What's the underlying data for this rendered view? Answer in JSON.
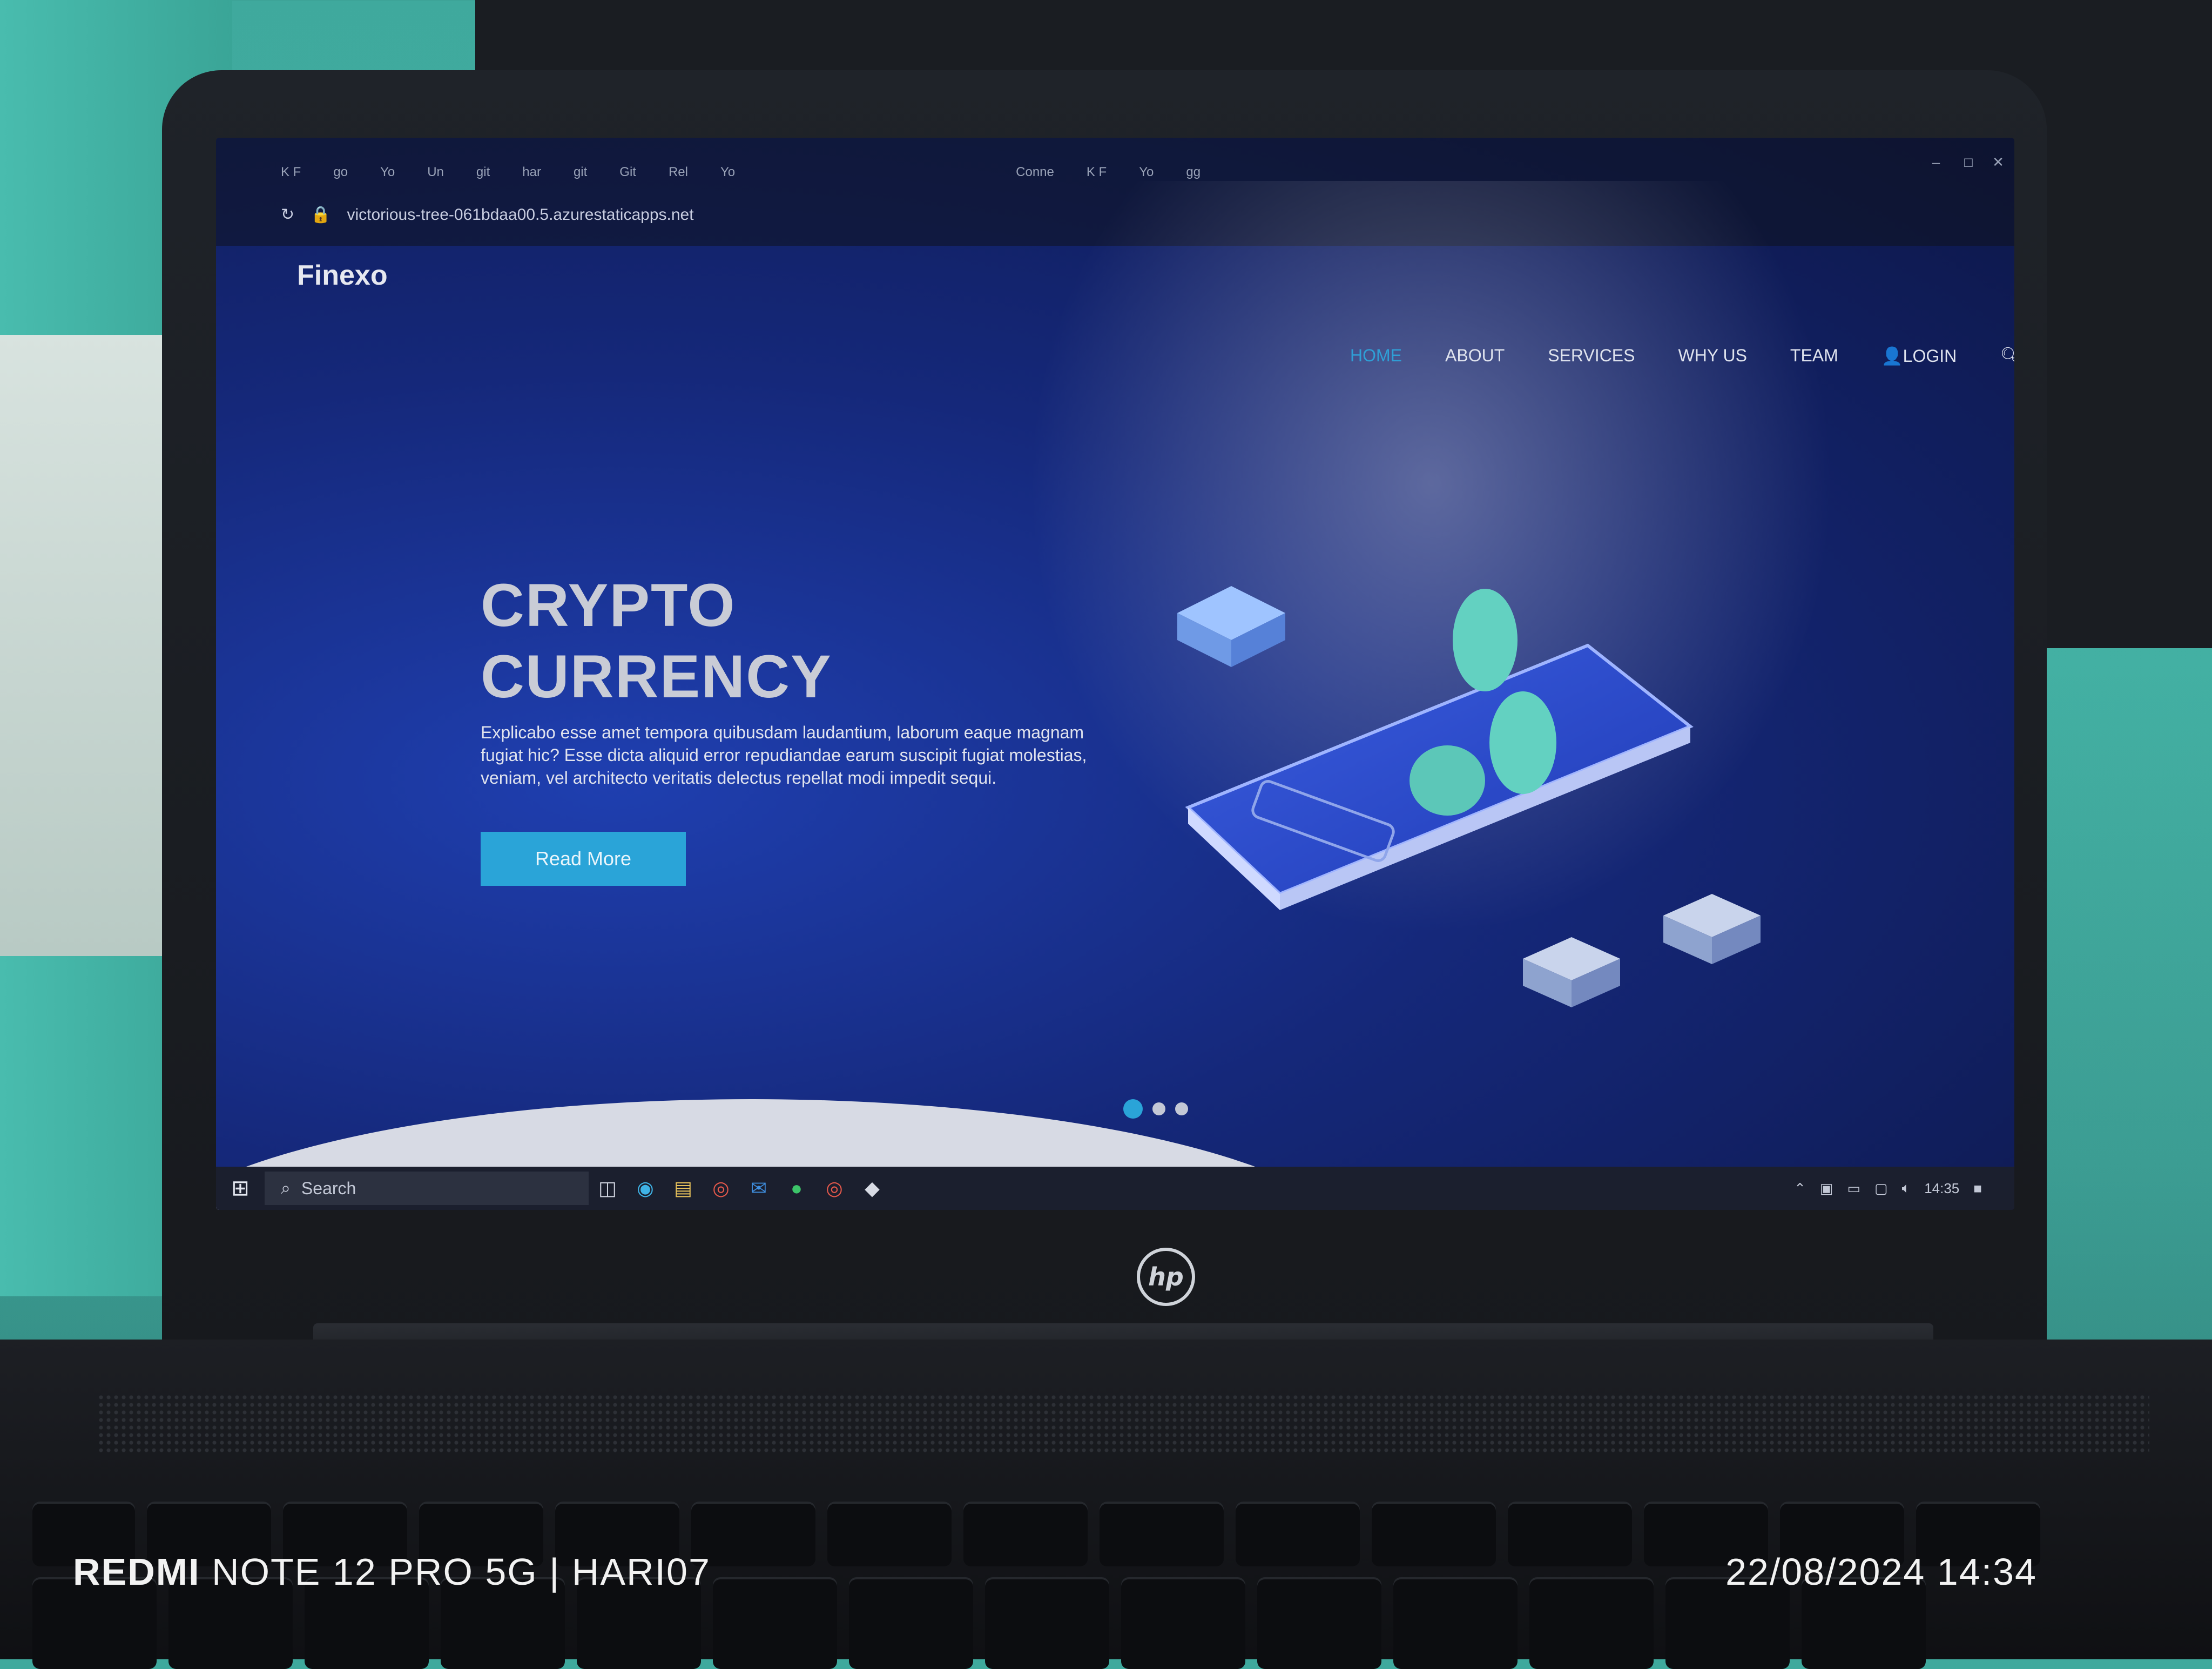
{
  "browser": {
    "tabs": [
      "K F",
      "go",
      "Yo",
      "Un",
      "git",
      "har",
      "git",
      "Git",
      "Rel",
      "Yo"
    ],
    "extra_tabs": [
      "Conne",
      "K F",
      "Yo",
      "gg"
    ],
    "url": "victorious-tree-061bdaa00.5.azurestaticapps.net"
  },
  "site": {
    "brand": "Finexo",
    "nav": [
      {
        "label": "HOME",
        "active": true
      },
      {
        "label": "ABOUT",
        "active": false
      },
      {
        "label": "SERVICES",
        "active": false
      },
      {
        "label": "WHY US",
        "active": false
      },
      {
        "label": "TEAM",
        "active": false
      },
      {
        "label": "LOGIN",
        "active": false
      }
    ],
    "hero": {
      "title_line1": "CRYPTO",
      "title_line2": "CURRENCY",
      "text": "Explicabo esse amet tempora quibusdam laudantium, laborum eaque magnam fugiat hic? Esse dicta aliquid error repudiandae earum suscipit fugiat molestias, veniam, vel architecto veritatis delectus repellat modi impedit sequi.",
      "button": "Read More"
    },
    "carousel": {
      "count": 3,
      "active_index": 0
    }
  },
  "taskbar": {
    "search_label": "Search",
    "time": "14:35"
  },
  "device": {
    "brand_logo": "hp"
  },
  "watermark": {
    "brand": "REDMI",
    "model": "NOTE 12 PRO 5G | HARI07",
    "datetime": "22/08/2024  14:34"
  },
  "colors": {
    "accent": "#2aa4d8",
    "screen_bg": "#15287a",
    "taskbar": "#1b1f2e"
  }
}
